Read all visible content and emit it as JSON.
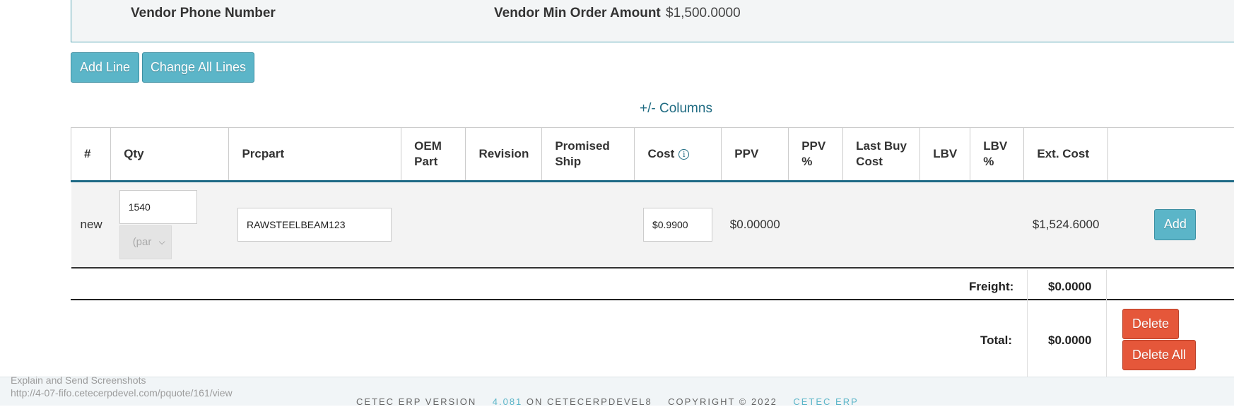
{
  "vendor_panel": {
    "phone_label": "Vendor Phone Number",
    "min_order_label": "Vendor Min Order Amount",
    "min_order_value": "$1,500.0000"
  },
  "toolbar": {
    "add_line_label": "Add Line",
    "change_all_lines_label": "Change All Lines"
  },
  "columns_toggle": "+/- Columns",
  "table": {
    "headers": {
      "num": "#",
      "qty": "Qty",
      "prcpart": "Prcpart",
      "oem_part_1": "OEM",
      "oem_part_2": "Part",
      "revision": "Revision",
      "promised_ship_1": "Promised",
      "promised_ship_2": "Ship",
      "cost": "Cost",
      "ppv": "PPV",
      "ppv_pct_1": "PPV",
      "ppv_pct_2": "%",
      "last_buy_cost_1": "Last Buy",
      "last_buy_cost_2": "Cost",
      "lbv": "LBV",
      "lbv_pct_1": "LBV",
      "lbv_pct_2": "%",
      "ext_cost": "Ext. Cost"
    },
    "new_row": {
      "row_label": "new",
      "qty_value": "1540",
      "unit_placeholder": "(par",
      "prcpart_value": "RAWSTEELBEAM123",
      "cost_value": "$0.9900",
      "ppv_value": "$0.00000",
      "ext_cost_value": "$1,524.6000",
      "add_label": "Add"
    }
  },
  "summary": {
    "freight_label": "Freight:",
    "freight_value": "$0.0000",
    "total_label": "Total:",
    "total_value": "$0.0000",
    "delete_label": "Delete",
    "delete_all_label": "Delete All"
  },
  "extension_overlay": {
    "line1": "Explain and Send Screenshots",
    "line2": "http://4-07-fifo.cetecerpdevel.com/pquote/161/view"
  },
  "footer": {
    "version_prefix": "CETEC ERP VERSION",
    "version_number": "4.081",
    "host_text": "ON CETECERPDEVEL8",
    "copyright": "COPYRIGHT © 2022",
    "brand_link": "CETEC ERP"
  },
  "colors": {
    "info_button": "#5bb5c8",
    "danger_button": "#e5573a",
    "header_rule": "#1e6a86",
    "link": "#1f6b82"
  }
}
